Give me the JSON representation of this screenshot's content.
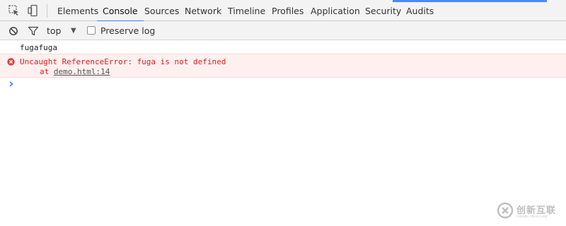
{
  "tabs": {
    "elements": "Elements",
    "console": "Console",
    "sources": "Sources",
    "network": "Network",
    "timeline": "Timeline",
    "profiles": "Profiles",
    "application": "Application",
    "security": "Security",
    "audits": "Audits",
    "active": "Console"
  },
  "toolbar": {
    "context": "top",
    "context_arrow": "▼",
    "preserve_log_label": "Preserve log",
    "preserve_log_checked": false
  },
  "console": {
    "log_message": "fugafuga",
    "error_message": "Uncaught ReferenceError: fuga is not defined",
    "error_stack_prefix": "at",
    "error_stack_link": "demo.html:14",
    "prompt_symbol": "›"
  },
  "watermark": {
    "text": "创新互联",
    "subtext": "CHUANG XIN HU LIAN"
  },
  "icons": {
    "inspect": "inspect-element-icon",
    "device": "device-toolbar-icon",
    "clear": "clear-console-icon",
    "filter": "filter-icon",
    "error": "error-circle-icon",
    "prompt": "prompt-chevron-icon"
  },
  "colors": {
    "active_tab_underline": "#3e82f7",
    "error_text": "#e11b1b",
    "error_background": "#fff0f0",
    "prompt": "#3e82f7"
  }
}
